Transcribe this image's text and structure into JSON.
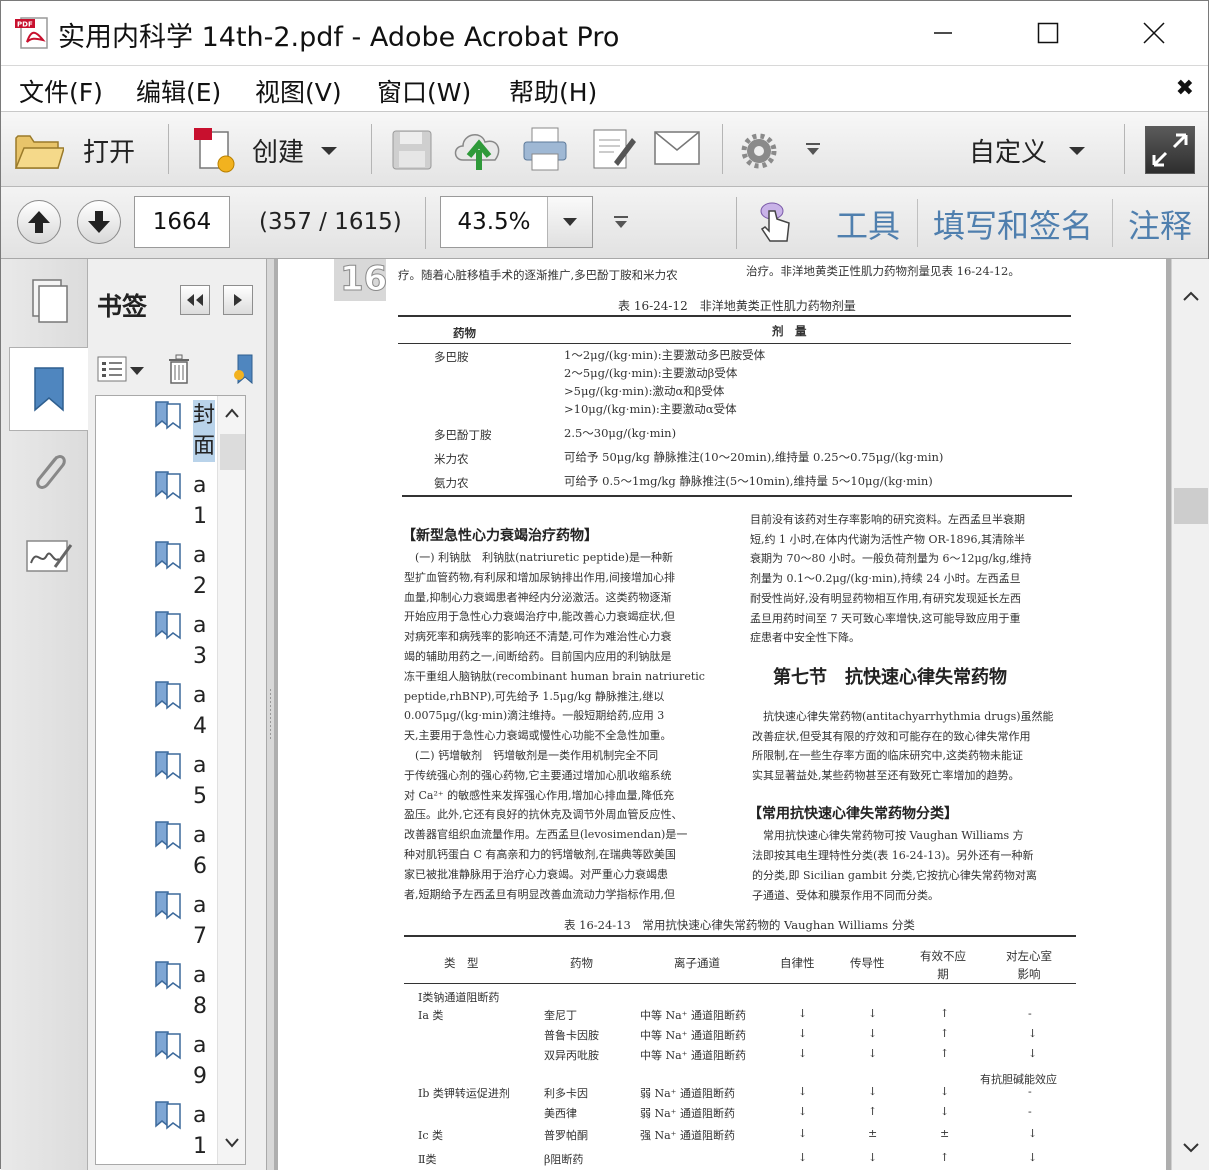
{
  "window": {
    "title": "实用内科学 14th-2.pdf - Adobe Acrobat Pro"
  },
  "menu": [
    "文件(F)",
    "编辑(E)",
    "视图(V)",
    "窗口(W)",
    "帮助(H)"
  ],
  "toolbar": {
    "open_label": "打开",
    "create_label": "创建",
    "customize_label": "自定义"
  },
  "nav": {
    "page_input": "1664",
    "page_count": "(357 / 1615)",
    "zoom": "43.5%"
  },
  "panels": {
    "tools": "工具",
    "fill_sign": "填写和签名",
    "comment": "注释"
  },
  "bookmarks": {
    "title": "书签",
    "items": [
      "封面",
      "a1",
      "a2",
      "a3",
      "a4",
      "a5",
      "a6",
      "a7",
      "a8",
      "a9",
      "a1"
    ]
  },
  "icons": {
    "logo": "pdf-logo-icon",
    "open": "folder-icon",
    "create": "create-pdf-icon",
    "save": "save-icon",
    "cloud": "cloud-upload-icon",
    "print": "printer-icon",
    "edit": "edit-icon",
    "mail": "mail-icon",
    "settings": "gear-icon",
    "prev": "arrow-up-icon",
    "next": "arrow-down-icon",
    "hand": "touch-hand-icon",
    "pages": "pages-icon",
    "bookmark": "bookmark-icon",
    "attachment": "paperclip-icon",
    "signature": "signature-icon"
  },
  "document": {
    "chapter_tab": "16",
    "top_line_left": "疗。随着心脏移植手术的逐渐推广,多巴酚丁胺和米力农",
    "top_line_right": "治疗。非洋地黄类正性肌力药物剂量见表 16-24-12。",
    "table1": {
      "caption": "表 16-24-12　非洋地黄类正性肌力药物剂量",
      "headers": [
        "药物",
        "剂　量"
      ],
      "rows": [
        {
          "drug": "多巴胺",
          "dose": "1～2μg/(kg·min):主要激动多巴胺受体"
        },
        {
          "drug": "",
          "dose": "2～5μg/(kg·min):主要激动β受体"
        },
        {
          "drug": "",
          "dose": ">5μg/(kg·min):激动α和β受体"
        },
        {
          "drug": "",
          "dose": ">10μg/(kg·min):主要激动α受体"
        },
        {
          "drug": "多巴酚丁胺",
          "dose": "2.5～30μg/(kg·min)"
        },
        {
          "drug": "米力农",
          "dose": "可给予 50μg/kg 静脉推注(10～20min),维持量 0.25～0.75μg/(kg·min)"
        },
        {
          "drug": "氨力农",
          "dose": "可给予 0.5～1mg/kg 静脉推注(5～10min),维持量 5～10μg/(kg·min)"
        }
      ]
    },
    "section_left_title": "【新型急性心力衰竭治疗药物】",
    "left_lines": [
      "　(一) 利钠肽　利钠肽(natriuretic peptide)是一种新",
      "型扩血管药物,有利尿和增加尿钠排出作用,间接增加心排",
      "血量,抑制心力衰竭患者神经内分泌激活。这类药物逐渐",
      "开始应用于急性心力衰竭治疗中,能改善心力衰竭症状,但",
      "对病死率和病残率的影响还不清楚,可作为难治性心力衰",
      "竭的辅助用药之一,间断给药。目前国内应用的利钠肽是",
      "冻干重组人脑钠肽(recombinant human brain natriuretic",
      "peptide,rhBNP),可先给予 1.5μg/kg 静脉推注,继以",
      "0.0075μg/(kg·min)滴注维持。一般短期给药,应用 3",
      "天,主要用于急性心力衰竭或慢性心功能不全急性加重。",
      "　(二) 钙增敏剂　钙增敏剂是一类作用机制完全不同",
      "于传统强心剂的强心药物,它主要通过增加心肌收缩系统",
      "对 Ca²⁺ 的敏感性来发挥强心作用,增加心排血量,降低充",
      "盈压。此外,它还有良好的抗休克及调节外周血管反应性、",
      "改善器官组织血流量作用。左西孟旦(levosimendan)是一",
      "种对肌钙蛋白 C 有高亲和力的钙增敏剂,在瑞典等欧美国",
      "家已被批准静脉用于治疗心力衰竭。对严重心力衰竭患",
      "者,短期给予左西孟旦有明显改善血流动力学指标作用,但"
    ],
    "right_lines_top": [
      "目前没有该药对生存率影响的研究资料。左西孟旦半衰期",
      "短,约 1 小时,在体内代谢为活性产物 OR-1896,其清除半",
      "衰期为 70～80 小时。一般负荷剂量为 6～12μg/kg,维持",
      "剂量为 0.1～0.2μg/(kg·min),持续 24 小时。左西孟旦",
      "耐受性尚好,没有明显药物相互作用,有研究发现延长左西",
      "孟旦用药时间至 7 天可致心率增快,这可能导致应用于重",
      "症患者中安全性下降。"
    ],
    "section7_title": "第七节　抗快速心律失常药物",
    "section7_lines": [
      "　抗快速心律失常药物(antitachyarrhythmia drugs)虽然能",
      "改善症状,但受其有限的疗效和可能存在的致心律失常作用",
      "所限制,在一些生存率方面的临床研究中,这类药物未能证",
      "实其显著益处,某些药物甚至还有致死亡率增加的趋势。"
    ],
    "section_right_title": "【常用抗快速心律失常药物分类】",
    "right_lines_bottom": [
      "　常用抗快速心律失常药物可按 Vaughan Williams 方",
      "法即按其电生理特性分类(表 16-24-13)。另外还有一种新",
      "的分类,即 Sicilian gambit 分类,它按抗心律失常药物对离",
      "子通道、受体和膜泵作用不同而分类。"
    ],
    "table2": {
      "caption": "表 16-24-13　常用抗快速心律失常药物的 Vaughan Williams 分类",
      "headers": [
        "类　型",
        "药物",
        "离子通道",
        "自律性",
        "传导性",
        "有效不应期",
        "对左心室影响"
      ],
      "rows": [
        {
          "type": "Ⅰ类钠通道阻断药",
          "drug": "",
          "channel": "",
          "auto": "",
          "cond": "",
          "erp": "",
          "lv": ""
        },
        {
          "type": "Ⅰa 类",
          "drug": "奎尼丁",
          "channel": "中等 Na⁺ 通道阻断药",
          "auto": "↓",
          "cond": "↓",
          "erp": "↑",
          "lv": "-"
        },
        {
          "type": "",
          "drug": "普鲁卡因胺",
          "channel": "中等 Na⁺ 通道阻断药",
          "auto": "↓",
          "cond": "↓",
          "erp": "↑",
          "lv": "↓"
        },
        {
          "type": "",
          "drug": "双异丙吡胺",
          "channel": "中等 Na⁺ 通道阻断药",
          "auto": "↓",
          "cond": "↓",
          "erp": "↑",
          "lv": "↓"
        },
        {
          "type": "",
          "drug": "",
          "channel": "",
          "auto": "",
          "cond": "",
          "erp": "",
          "lv": "有抗胆碱能效应"
        },
        {
          "type": "Ⅰb 类钾转运促进剂",
          "drug": "利多卡因",
          "channel": "弱 Na⁺ 通道阻断药",
          "auto": "↓",
          "cond": "↓",
          "erp": "↓",
          "lv": "-"
        },
        {
          "type": "",
          "drug": "美西律",
          "channel": "弱 Na⁺ 通道阻断药",
          "auto": "↓",
          "cond": "↑",
          "erp": "↓",
          "lv": "-"
        },
        {
          "type": "Ⅰc 类",
          "drug": "普罗帕酮",
          "channel": "强 Na⁺ 通道阻断药",
          "auto": "↓",
          "cond": "±",
          "erp": "±",
          "lv": "↓"
        },
        {
          "type": "Ⅱ类",
          "drug": "β阻断药",
          "channel": "",
          "auto": "↓",
          "cond": "↓",
          "erp": "↑",
          "lv": "↓"
        }
      ]
    }
  }
}
